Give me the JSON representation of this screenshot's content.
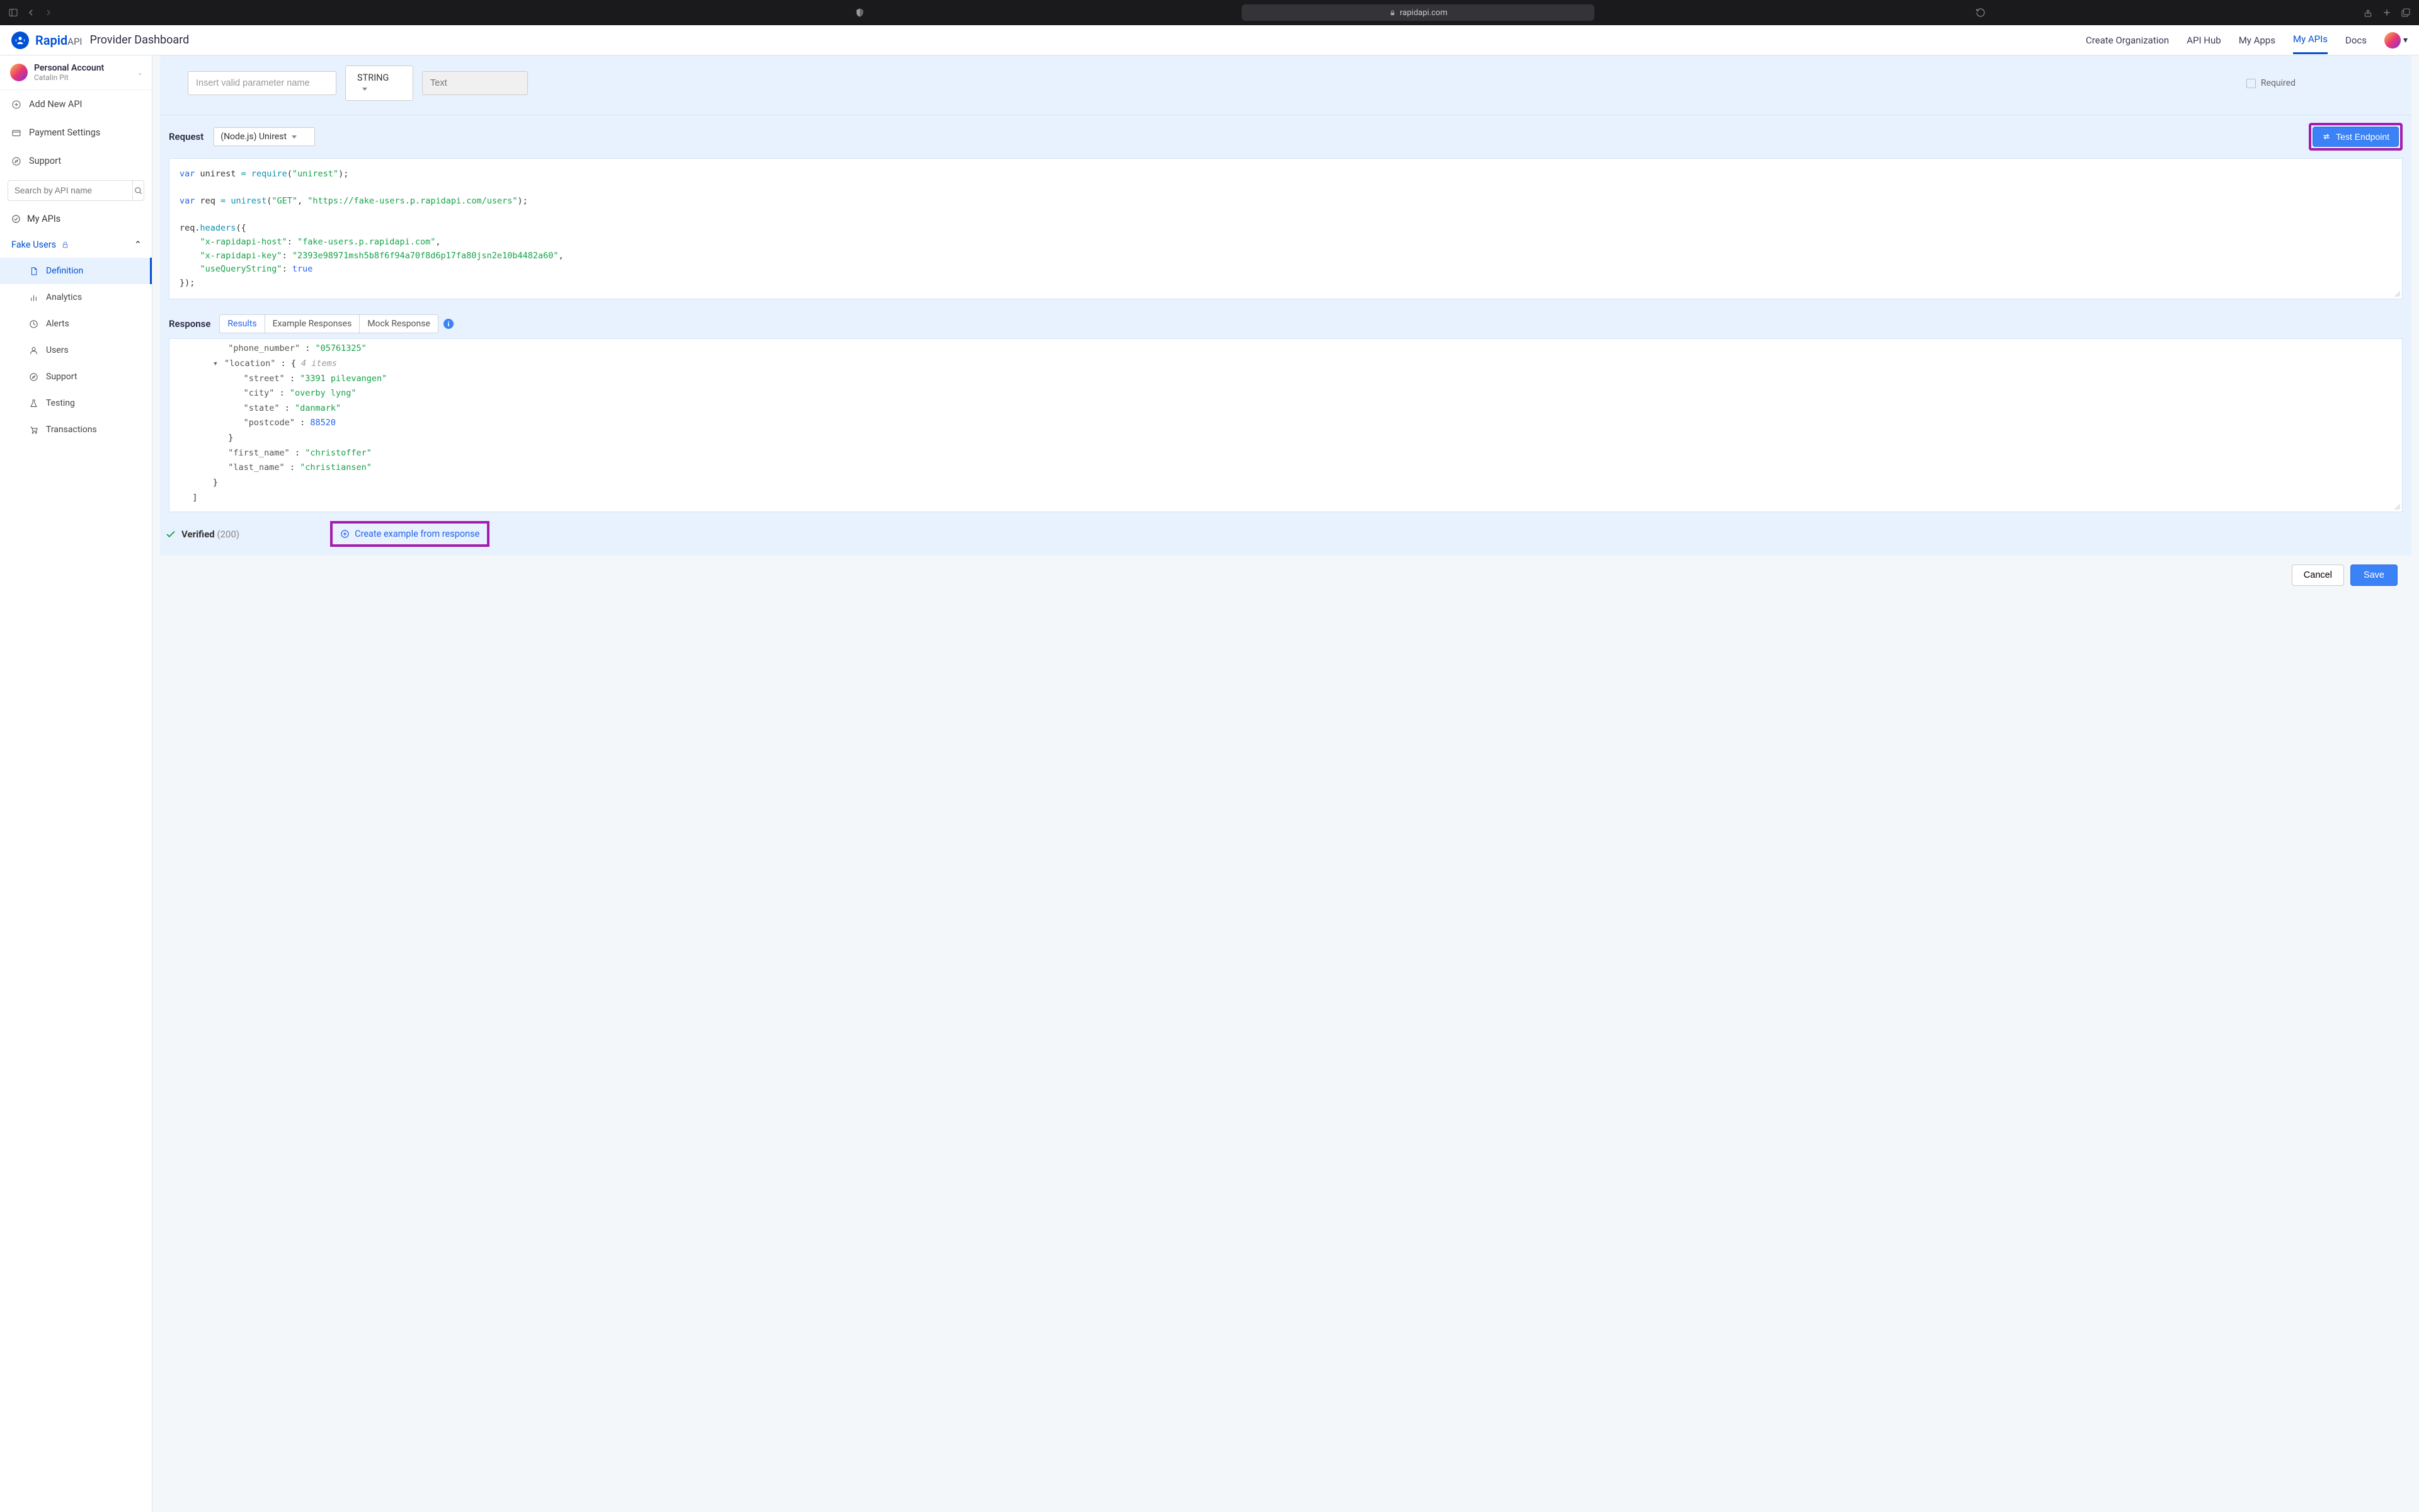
{
  "browser": {
    "url": "rapidapi.com"
  },
  "header": {
    "brand": "Rapid",
    "brand_suffix": "API",
    "title": "Provider Dashboard",
    "nav": {
      "create_org": "Create Organization",
      "api_hub": "API Hub",
      "my_apps": "My Apps",
      "my_apis": "My APIs",
      "docs": "Docs"
    }
  },
  "sidebar": {
    "account": {
      "title": "Personal Account",
      "name": "Catalin Pit"
    },
    "add_api": "Add New API",
    "payment": "Payment Settings",
    "support": "Support",
    "search_placeholder": "Search by API name",
    "section": "My APIs",
    "api_name": "Fake Users",
    "items": {
      "definition": "Definition",
      "analytics": "Analytics",
      "alerts": "Alerts",
      "users": "Users",
      "support": "Support",
      "testing": "Testing",
      "transactions": "Transactions"
    }
  },
  "params": {
    "name_placeholder": "Insert valid parameter name",
    "type": "STRING",
    "text_placeholder": "Text",
    "required": "Required"
  },
  "request": {
    "title": "Request",
    "language": "(Node.js) Unirest",
    "test_button": "Test Endpoint",
    "code": {
      "l1_var": "var",
      "l1_name": "unirest",
      "l1_fn": "require",
      "l1_arg": "\"unirest\"",
      "l2_var": "var",
      "l2_name": "req",
      "l2_obj": "unirest",
      "l2_method": "\"GET\"",
      "l2_url": "\"https://fake-users.p.rapidapi.com/users\"",
      "l3_obj": "req",
      "l3_fn": "headers",
      "h1_k": "\"x-rapidapi-host\"",
      "h1_v": "\"fake-users.p.rapidapi.com\"",
      "h2_k": "\"x-rapidapi-key\"",
      "h2_v": "\"2393e98971msh5b8f6f94a70f8d6p17fa80jsn2e10b4482a60\"",
      "h3_k": "\"useQueryString\"",
      "h3_v": "true"
    }
  },
  "response": {
    "title": "Response",
    "tabs": {
      "results": "Results",
      "examples": "Example Responses",
      "mock": "Mock Response"
    },
    "json": {
      "phone_label": "\"phone_number\"",
      "phone_val": "\"05761325\"",
      "loc_label": "\"location\"",
      "loc_count": "4 items",
      "street_k": "\"street\"",
      "street_v": "\"3391 pilevangen\"",
      "city_k": "\"city\"",
      "city_v": "\"overby lyng\"",
      "state_k": "\"state\"",
      "state_v": "\"danmark\"",
      "post_k": "\"postcode\"",
      "post_v": "88520",
      "first_k": "\"first_name\"",
      "first_v": "\"christoffer\"",
      "last_k": "\"last_name\"",
      "last_v": "\"christiansen\""
    },
    "verified": "Verified",
    "status_code": "(200)",
    "create_example": "Create example from response"
  },
  "footer": {
    "cancel": "Cancel",
    "save": "Save"
  }
}
